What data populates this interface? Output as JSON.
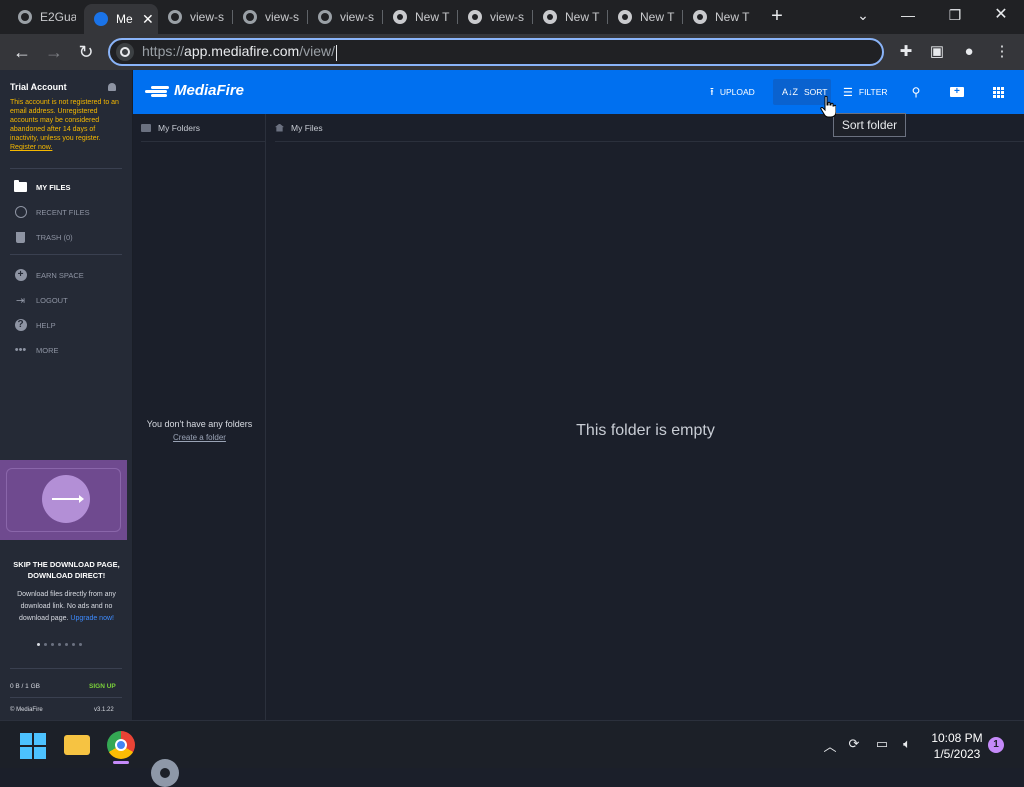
{
  "browser": {
    "tabs": [
      {
        "label": "E2Gua",
        "icon": "globe-icon"
      },
      {
        "label": "Me",
        "icon": "mediafire-icon",
        "active": true
      },
      {
        "label": "view-s",
        "icon": "globe-icon"
      },
      {
        "label": "view-s",
        "icon": "globe-icon"
      },
      {
        "label": "view-s",
        "icon": "globe-icon"
      },
      {
        "label": "New T",
        "icon": "chrome-icon"
      },
      {
        "label": "view-s",
        "icon": "chrome-icon"
      },
      {
        "label": "New T",
        "icon": "chrome-icon"
      },
      {
        "label": "New T",
        "icon": "chrome-icon"
      },
      {
        "label": "New T",
        "icon": "chrome-icon"
      }
    ],
    "close_glyph": "✕",
    "new_tab_glyph": "+",
    "url_prefix": "https://",
    "url_host": "app.mediafire.com",
    "url_path": "/view/"
  },
  "sidebar": {
    "account_title": "Trial Account",
    "trial_notice": "This account is not registered to an email address. Unregistered accounts may be considered abandoned after 14 days of inactivity, unless you register.",
    "register_link": "Register now.",
    "nav": [
      {
        "label": "MY FILES",
        "icon": "folder-icon",
        "active": true
      },
      {
        "label": "RECENT FILES",
        "icon": "clock-icon"
      },
      {
        "label": "TRASH (0)",
        "icon": "trash-icon"
      }
    ],
    "nav2": [
      {
        "label": "EARN SPACE",
        "icon": "plus-circle-icon"
      },
      {
        "label": "LOGOUT",
        "icon": "logout-icon"
      },
      {
        "label": "HELP",
        "icon": "help-icon"
      },
      {
        "label": "MORE",
        "icon": "more-icon"
      }
    ],
    "promo": {
      "title": "SKIP THE DOWNLOAD PAGE, DOWNLOAD DIRECT!",
      "text": "Download files directly from any download link. No ads and no download page.",
      "link": "Upgrade now!",
      "slide_count": 7,
      "active_slide": 1
    },
    "storage": "0 B / 1 GB",
    "signup": "SIGN UP",
    "copyright": "© MediaFire",
    "version": "v3.1.22"
  },
  "topnav": {
    "logo": "MediaFire",
    "upload": "UPLOAD",
    "sort": "SORT",
    "sort_icon": "A↓Z",
    "filter": "FILTER",
    "tooltip": "Sort folder"
  },
  "folders_pane": {
    "header": "My Folders",
    "empty": "You don't have any folders",
    "create": "Create a folder"
  },
  "files_pane": {
    "breadcrumb": "My Files",
    "empty": "This folder is empty"
  },
  "taskbar": {
    "time": "10:08 PM",
    "date": "1/5/2023",
    "notifications": "1"
  },
  "colors": {
    "brand_blue": "#0070f0",
    "trial_warning": "#f5b800",
    "signup_green": "#7ad03a"
  }
}
